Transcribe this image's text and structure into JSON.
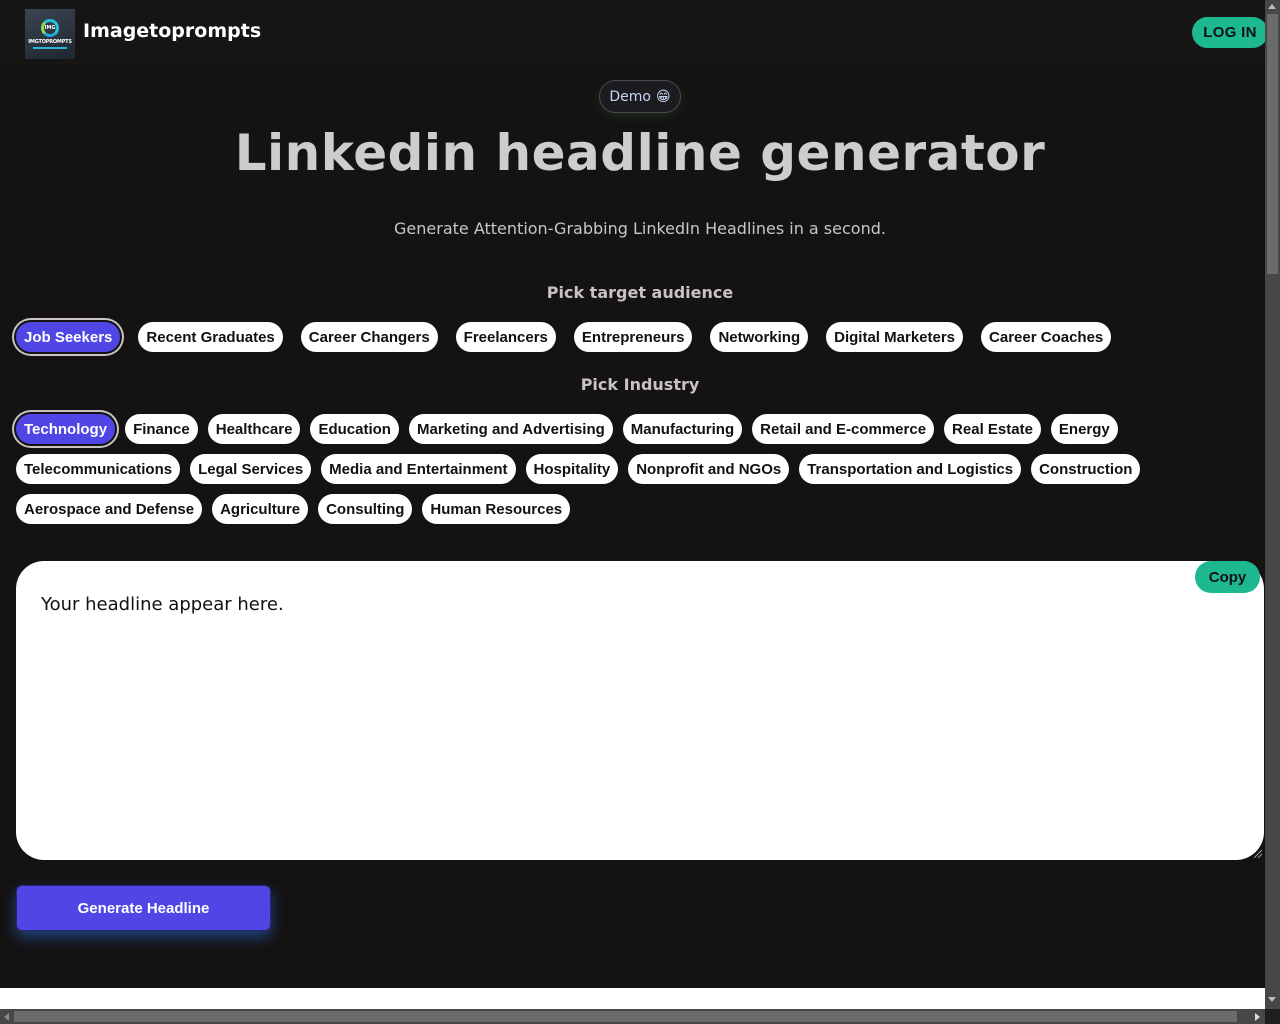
{
  "header": {
    "brand": "Imagetoprompts",
    "logo_text": "IMGTOPROMPTS",
    "logo_ring_text": "IMG",
    "login_label": "LOG IN"
  },
  "hero": {
    "badge_label": "Demo",
    "badge_icon": "😁",
    "title": "Linkedin headline generator",
    "subtitle": "Generate Attention-Grabbing LinkedIn Headlines in a second."
  },
  "audience": {
    "label": "Pick target audience",
    "selected": "Job Seekers",
    "options": [
      "Job Seekers",
      "Recent Graduates",
      "Career Changers",
      "Freelancers",
      "Entrepreneurs",
      "Networking",
      "Digital Marketers",
      "Career Coaches"
    ]
  },
  "industry": {
    "label": "Pick Industry",
    "selected": "Technology",
    "rows": [
      [
        "Technology",
        "Finance",
        "Healthcare",
        "Education",
        "Marketing and Advertising",
        "Manufacturing",
        "Retail and E-commerce",
        "Real Estate",
        "Energy"
      ],
      [
        "Telecommunications",
        "Legal Services",
        "Media and Entertainment",
        "Hospitality",
        "Nonprofit and NGOs",
        "Transportation and Logistics",
        "Construction"
      ],
      [
        "Aerospace and Defense",
        "Agriculture",
        "Consulting",
        "Human Resources"
      ]
    ]
  },
  "output": {
    "text": "Your headline appear here.",
    "copy_label": "Copy"
  },
  "actions": {
    "generate_label": "Generate Headline"
  },
  "colors": {
    "accent": "#4f46e5",
    "success": "#1db890",
    "background": "#151212"
  }
}
